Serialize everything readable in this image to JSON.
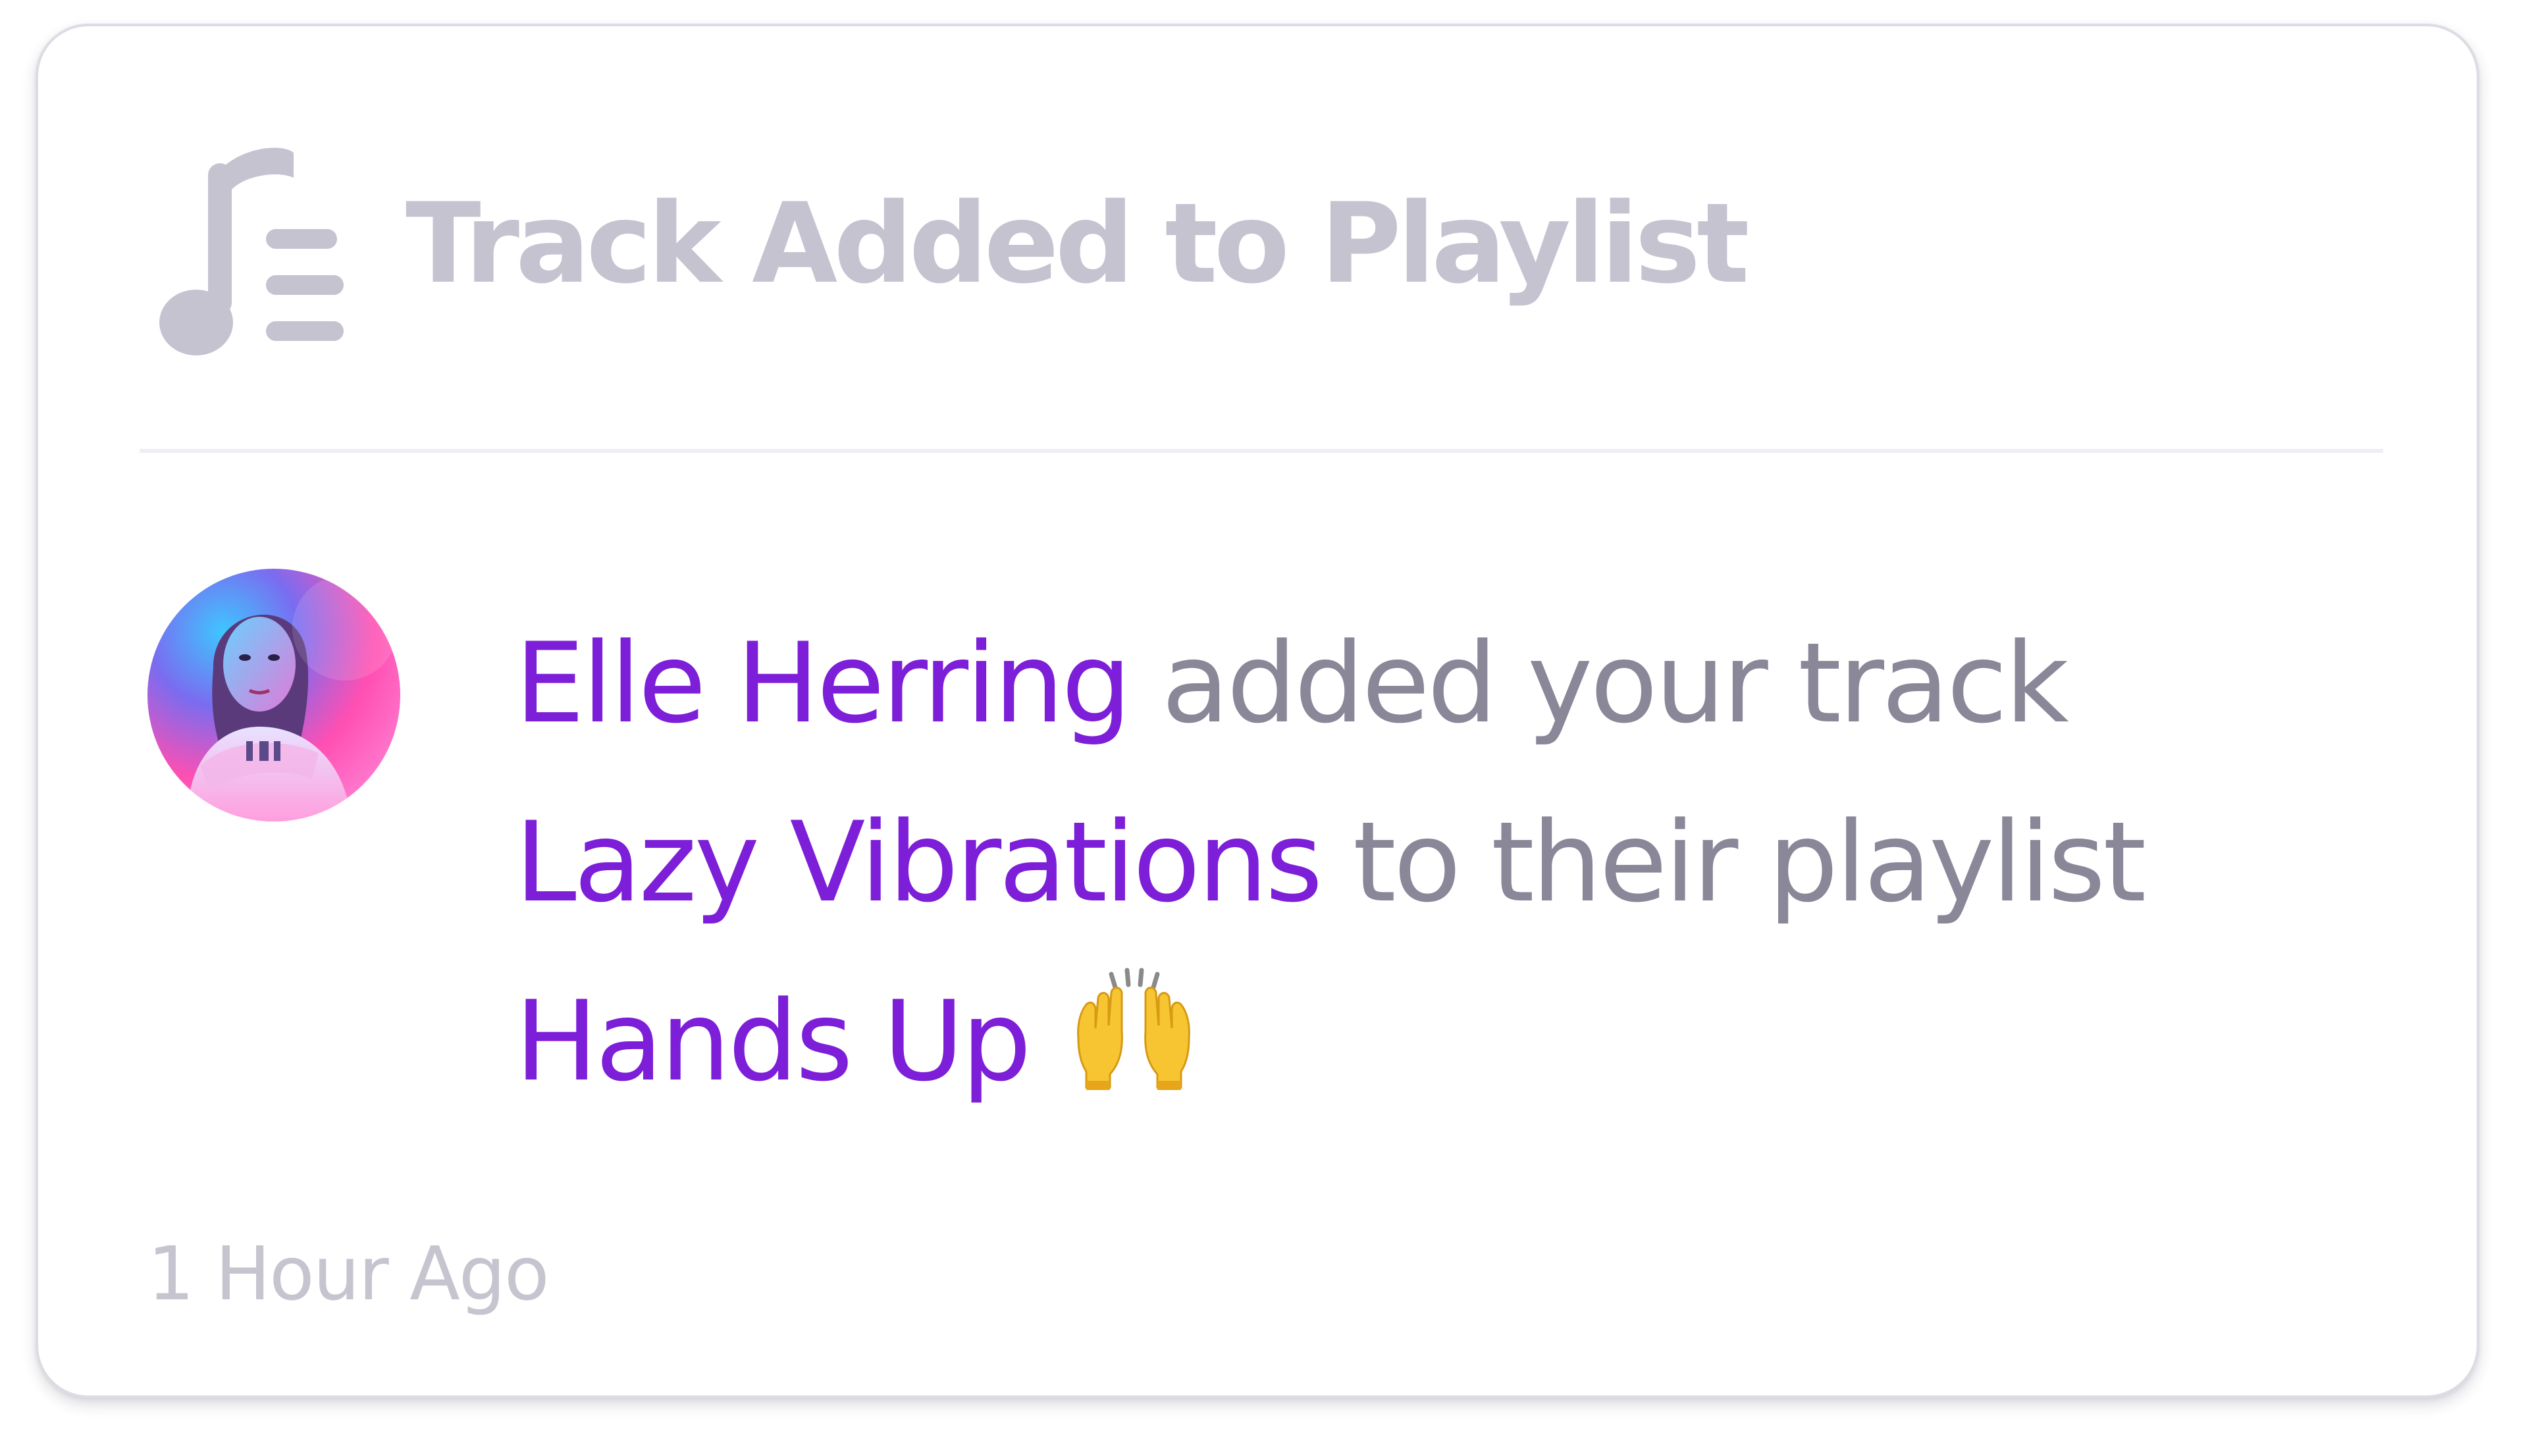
{
  "notification": {
    "type_icon": "music-playlist-icon",
    "title": "Track Added to Playlist",
    "avatar_icon": "user-avatar",
    "user_name": "Elle Herring",
    "text_added_your_track": " added your track",
    "track_name": "Lazy Vibrations",
    "text_to_their_playlist": " to their playlist",
    "playlist_name": "Hands Up",
    "emoji": "raising-hands-emoji",
    "timestamp": "1 Hour Ago"
  },
  "colors": {
    "title": "#c5c3d0",
    "highlight": "#7d1fd8",
    "body_text": "#8a8798",
    "timestamp": "#c6c4ce",
    "card_border": "#dcdce4",
    "divider": "#eeeef3"
  }
}
